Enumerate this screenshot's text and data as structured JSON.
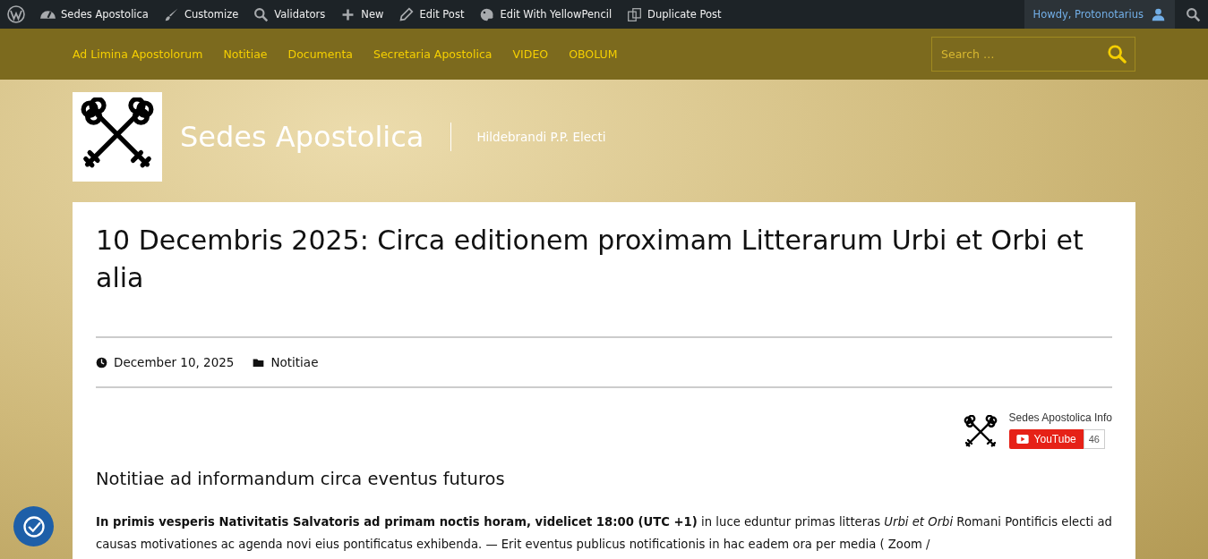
{
  "admin_bar": {
    "items": [
      {
        "kind": "wp"
      },
      {
        "kind": "dashboard",
        "label": "Sedes Apostolica"
      },
      {
        "kind": "brush",
        "label": "Customize"
      },
      {
        "kind": "validators",
        "label": "Validators"
      },
      {
        "kind": "plus",
        "label": "New"
      },
      {
        "kind": "pencil",
        "label": "Edit Post"
      },
      {
        "kind": "palette",
        "label": "Edit With YellowPencil"
      },
      {
        "kind": "copy",
        "label": "Duplicate Post"
      }
    ],
    "account": "Howdy, Protonotarius"
  },
  "nav": {
    "items": [
      "Ad Limina Apostolorum",
      "Notitiae",
      "Documenta",
      "Secretaria Apostolica",
      "VIDEO",
      "OBOLUM"
    ],
    "search": {
      "placeholder": "Search …"
    }
  },
  "site": {
    "title": "Sedes Apostolica",
    "tagline": "Hildebrandi P.P. Electi"
  },
  "post": {
    "title": "10 Decembris 2025: Circa editionem proximam Litterarum Urbi et Orbi et alia",
    "date": "December 10, 2025",
    "category": "Notitiae",
    "youtube": {
      "channel": "Sedes Apostolica Info",
      "button": "YouTube",
      "count": "46"
    },
    "heading": "Notitiae ad informandum circa eventus futuros",
    "paragraph": "**In primis vesperis Nativitatis Salvatoris ad primam noctis horam, videlicet 18:00 (UTC +1)** in luce eduntur primas litteras *Urbi et Orbi* Romani Pontificis electi ad causas motivationes ac agenda novi eius pontificatus exhibenda. — Erit eventus publicus notificationis in hac eadem ora per media ( Zoom /"
  }
}
